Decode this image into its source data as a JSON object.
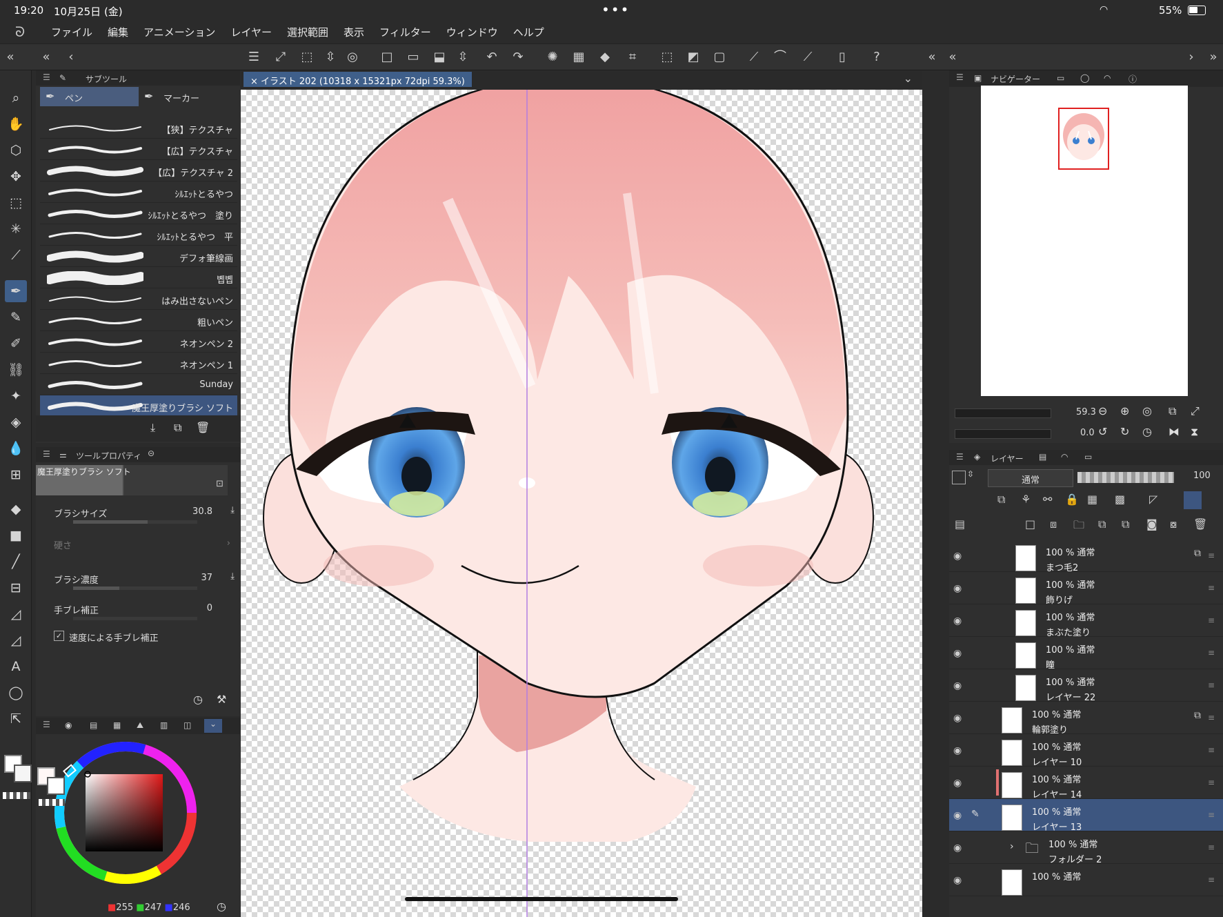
{
  "status": {
    "time": "19:20",
    "date": "10月25日 (金)",
    "battery": "55%"
  },
  "menu": {
    "items": [
      "ファイル",
      "編集",
      "アニメーション",
      "レイヤー",
      "選択範囲",
      "表示",
      "フィルター",
      "ウィンドウ",
      "ヘルプ"
    ]
  },
  "subtool": {
    "title": "サブツール",
    "tabs": [
      "ペン",
      "マーカー"
    ],
    "brushes": [
      "【狭】テクスチャ",
      "【広】テクスチャ",
      "【広】テクスチャ 2",
      "ｼﾙｴｯﾄとるやつ",
      "ｼﾙｴｯﾄとるやつ　塗り",
      "ｼﾙｴｯﾄとるやつ　平",
      "デフォ筆線画",
      "볩볩",
      "はみ出さないペン",
      "粗いペン",
      "ネオンペン 2",
      "ネオンペン 1",
      "Sunday",
      "魔王厚塗りブラシ ソフト"
    ]
  },
  "toolprop": {
    "title": "ツールプロパティ",
    "brush_name": "魔王厚塗りブラシ ソフト",
    "size_label": "ブラシサイズ",
    "size_value": "30.8",
    "hardness_label": "硬さ",
    "density_label": "ブラシ濃度",
    "density_value": "37",
    "stabilizer_label": "手ブレ補正",
    "stabilizer_value": "0",
    "speed_label": "速度による手ブレ補正"
  },
  "color": {
    "r": "255",
    "g": "247",
    "b": "246"
  },
  "canvas": {
    "tab_title": "イラスト 202 (10318 x 15321px 72dpi 59.3%)"
  },
  "navigator": {
    "title": "ナビゲーター",
    "zoom": "59.3",
    "angle": "0.0"
  },
  "layers": {
    "title": "レイヤー",
    "blend_mode": "通常",
    "opacity": "100",
    "items": [
      {
        "pct": "100 %  通常",
        "name": "まつ毛2"
      },
      {
        "pct": "100 %  通常",
        "name": "飾りげ"
      },
      {
        "pct": "100 %  通常",
        "name": "まぶた塗り"
      },
      {
        "pct": "100 %  通常",
        "name": "瞳"
      },
      {
        "pct": "100 %  通常",
        "name": "レイヤー 22"
      },
      {
        "pct": "100 %  通常",
        "name": "輪郭塗り"
      },
      {
        "pct": "100 %  通常",
        "name": "レイヤー 10"
      },
      {
        "pct": "100 %  通常",
        "name": "レイヤー 14"
      },
      {
        "pct": "100 %  通常",
        "name": "レイヤー 13"
      },
      {
        "pct": "100 %  通常",
        "name": "フォルダー 2"
      },
      {
        "pct": "100 %  通常",
        "name": ""
      }
    ]
  },
  "colors": {
    "accent": "#3d5680",
    "skin": "#fbe3df",
    "hair": "#f0a3a3",
    "iris": "#3b7fd0"
  }
}
